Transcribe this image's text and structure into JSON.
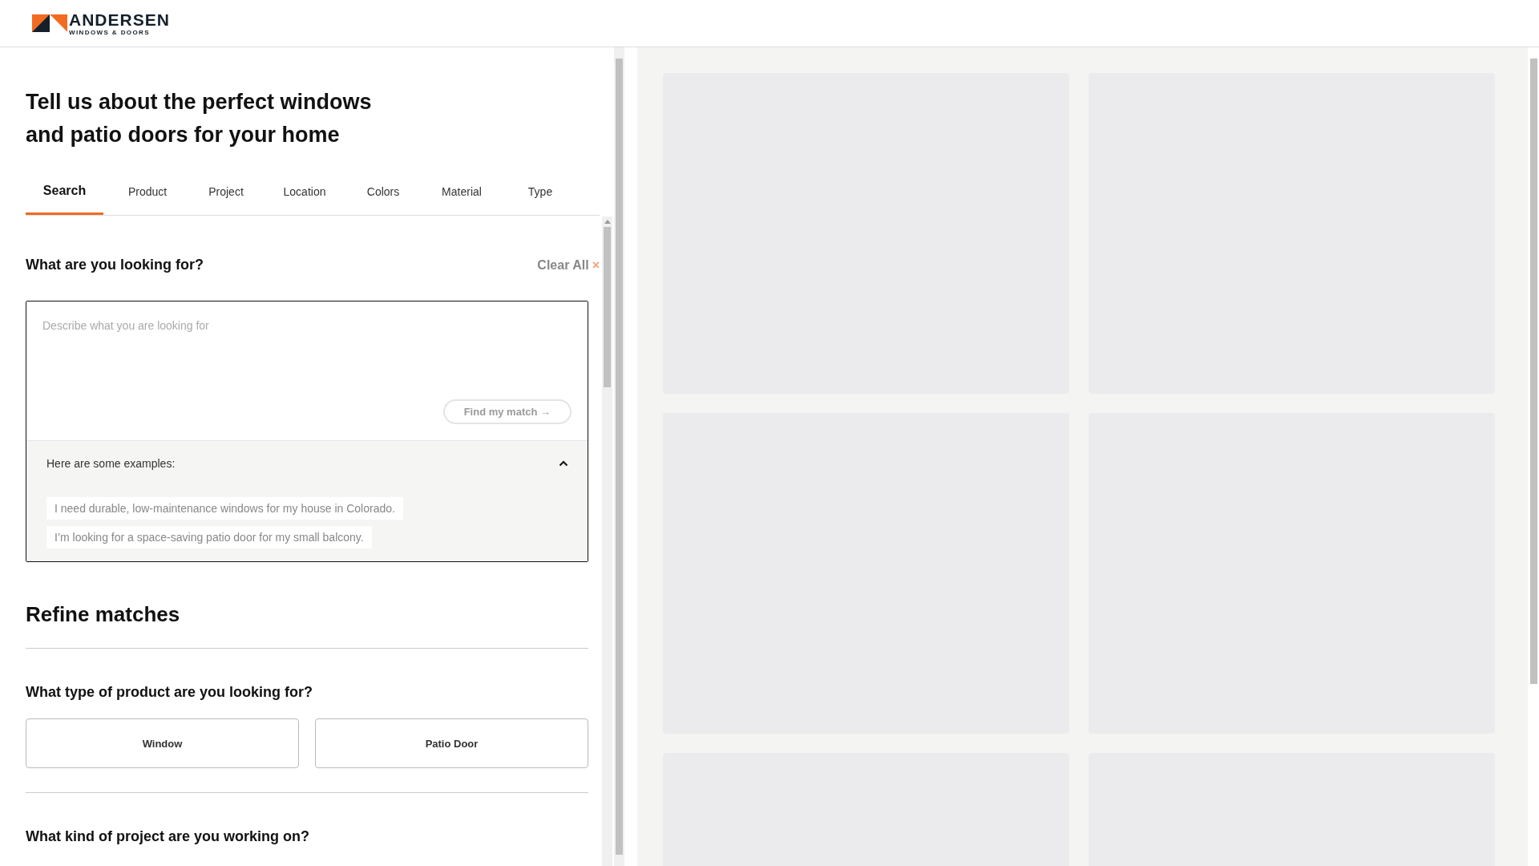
{
  "header": {
    "logo": {
      "name": "ANDERSEN",
      "tagline": "WINDOWS & DOORS"
    }
  },
  "title": "Tell us about the perfect windows and patio doors for your home",
  "tabs": [
    {
      "label": "Search",
      "selected": true
    },
    {
      "label": "Product",
      "selected": false
    },
    {
      "label": "Project",
      "selected": false
    },
    {
      "label": "Location",
      "selected": false
    },
    {
      "label": "Colors",
      "selected": false
    },
    {
      "label": "Material",
      "selected": false
    },
    {
      "label": "Type",
      "selected": false
    }
  ],
  "search": {
    "heading": "What are you looking for?",
    "clear_all": "Clear All",
    "clear_icon": "×",
    "placeholder": "Describe what you are looking for",
    "submit": "Find my match →",
    "submit_disabled": true,
    "examples": {
      "heading": "Here are some examples:",
      "expanded": true,
      "items": [
        "I need durable, low-maintenance windows for my house in Colorado.",
        "I’m looking for a space-saving patio door for my small balcony."
      ]
    }
  },
  "refine": {
    "heading": "Refine matches",
    "questions": [
      {
        "question": "What type of product are you looking for?",
        "options": [
          {
            "label": "Window",
            "selected": false
          },
          {
            "label": "Patio Door",
            "selected": false
          }
        ]
      },
      {
        "question": "What kind of project are you working on?"
      }
    ]
  }
}
